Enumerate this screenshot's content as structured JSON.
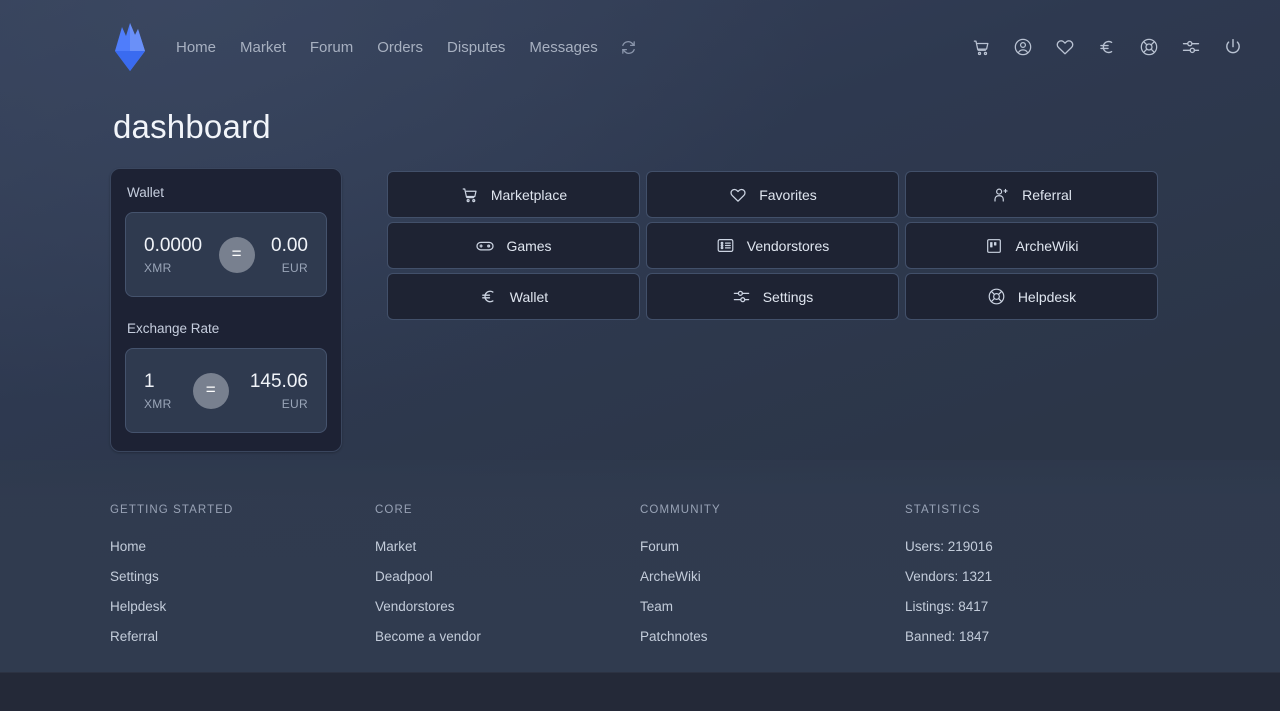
{
  "nav": {
    "logo_icon": "flame-logo-icon",
    "links": [
      {
        "label": "Home"
      },
      {
        "label": "Market"
      },
      {
        "label": "Forum"
      },
      {
        "label": "Orders"
      },
      {
        "label": "Disputes"
      },
      {
        "label": "Messages"
      }
    ],
    "refresh_icon": "refresh-icon",
    "icons": [
      {
        "name": "cart-icon"
      },
      {
        "name": "account-circle-icon"
      },
      {
        "name": "heart-icon"
      },
      {
        "name": "euro-icon"
      },
      {
        "name": "lifebuoy-icon"
      },
      {
        "name": "sliders-icon"
      },
      {
        "name": "power-icon"
      }
    ]
  },
  "page": {
    "title": "dashboard"
  },
  "wallet": {
    "wallet_label": "Wallet",
    "balance": {
      "left_value": "0.0000",
      "left_unit": "XMR",
      "operator": "=",
      "right_value": "0.00",
      "right_unit": "EUR"
    },
    "exchange_label": "Exchange Rate",
    "exchange": {
      "left_value": "1",
      "left_unit": "XMR",
      "operator": "=",
      "right_value": "145.06",
      "right_unit": "EUR"
    }
  },
  "tiles": [
    {
      "label": "Marketplace",
      "icon": "cart-icon"
    },
    {
      "label": "Favorites",
      "icon": "heart-icon"
    },
    {
      "label": "Referral",
      "icon": "user-plus-icon"
    },
    {
      "label": "Games",
      "icon": "gamepad-icon"
    },
    {
      "label": "Vendorstores",
      "icon": "list-card-icon"
    },
    {
      "label": "ArcheWiki",
      "icon": "book-icon"
    },
    {
      "label": "Wallet",
      "icon": "euro-icon"
    },
    {
      "label": "Settings",
      "icon": "sliders-icon"
    },
    {
      "label": "Helpdesk",
      "icon": "lifebuoy-icon"
    }
  ],
  "footer": {
    "columns": [
      {
        "title": "GETTING STARTED",
        "items": [
          "Home",
          "Settings",
          "Helpdesk",
          "Referral"
        ]
      },
      {
        "title": "CORE",
        "items": [
          "Market",
          "Deadpool",
          "Vendorstores",
          "Become a vendor"
        ]
      },
      {
        "title": "COMMUNITY",
        "items": [
          "Forum",
          "ArcheWiki",
          "Team",
          "Patchnotes"
        ]
      },
      {
        "title": "STATISTICS",
        "items": [
          "Users: 219016",
          "Vendors: 1321",
          "Listings: 8417",
          "Banned: 1847"
        ]
      }
    ]
  },
  "colors": {
    "background": "#2e3950",
    "panel": "#1d2234",
    "card": "#2f3a4f",
    "tile": "#1e2333",
    "accent": "#4f7dfb",
    "text": "#dfe5ef",
    "muted": "#98a2b5",
    "footer_bar": "#242938"
  }
}
